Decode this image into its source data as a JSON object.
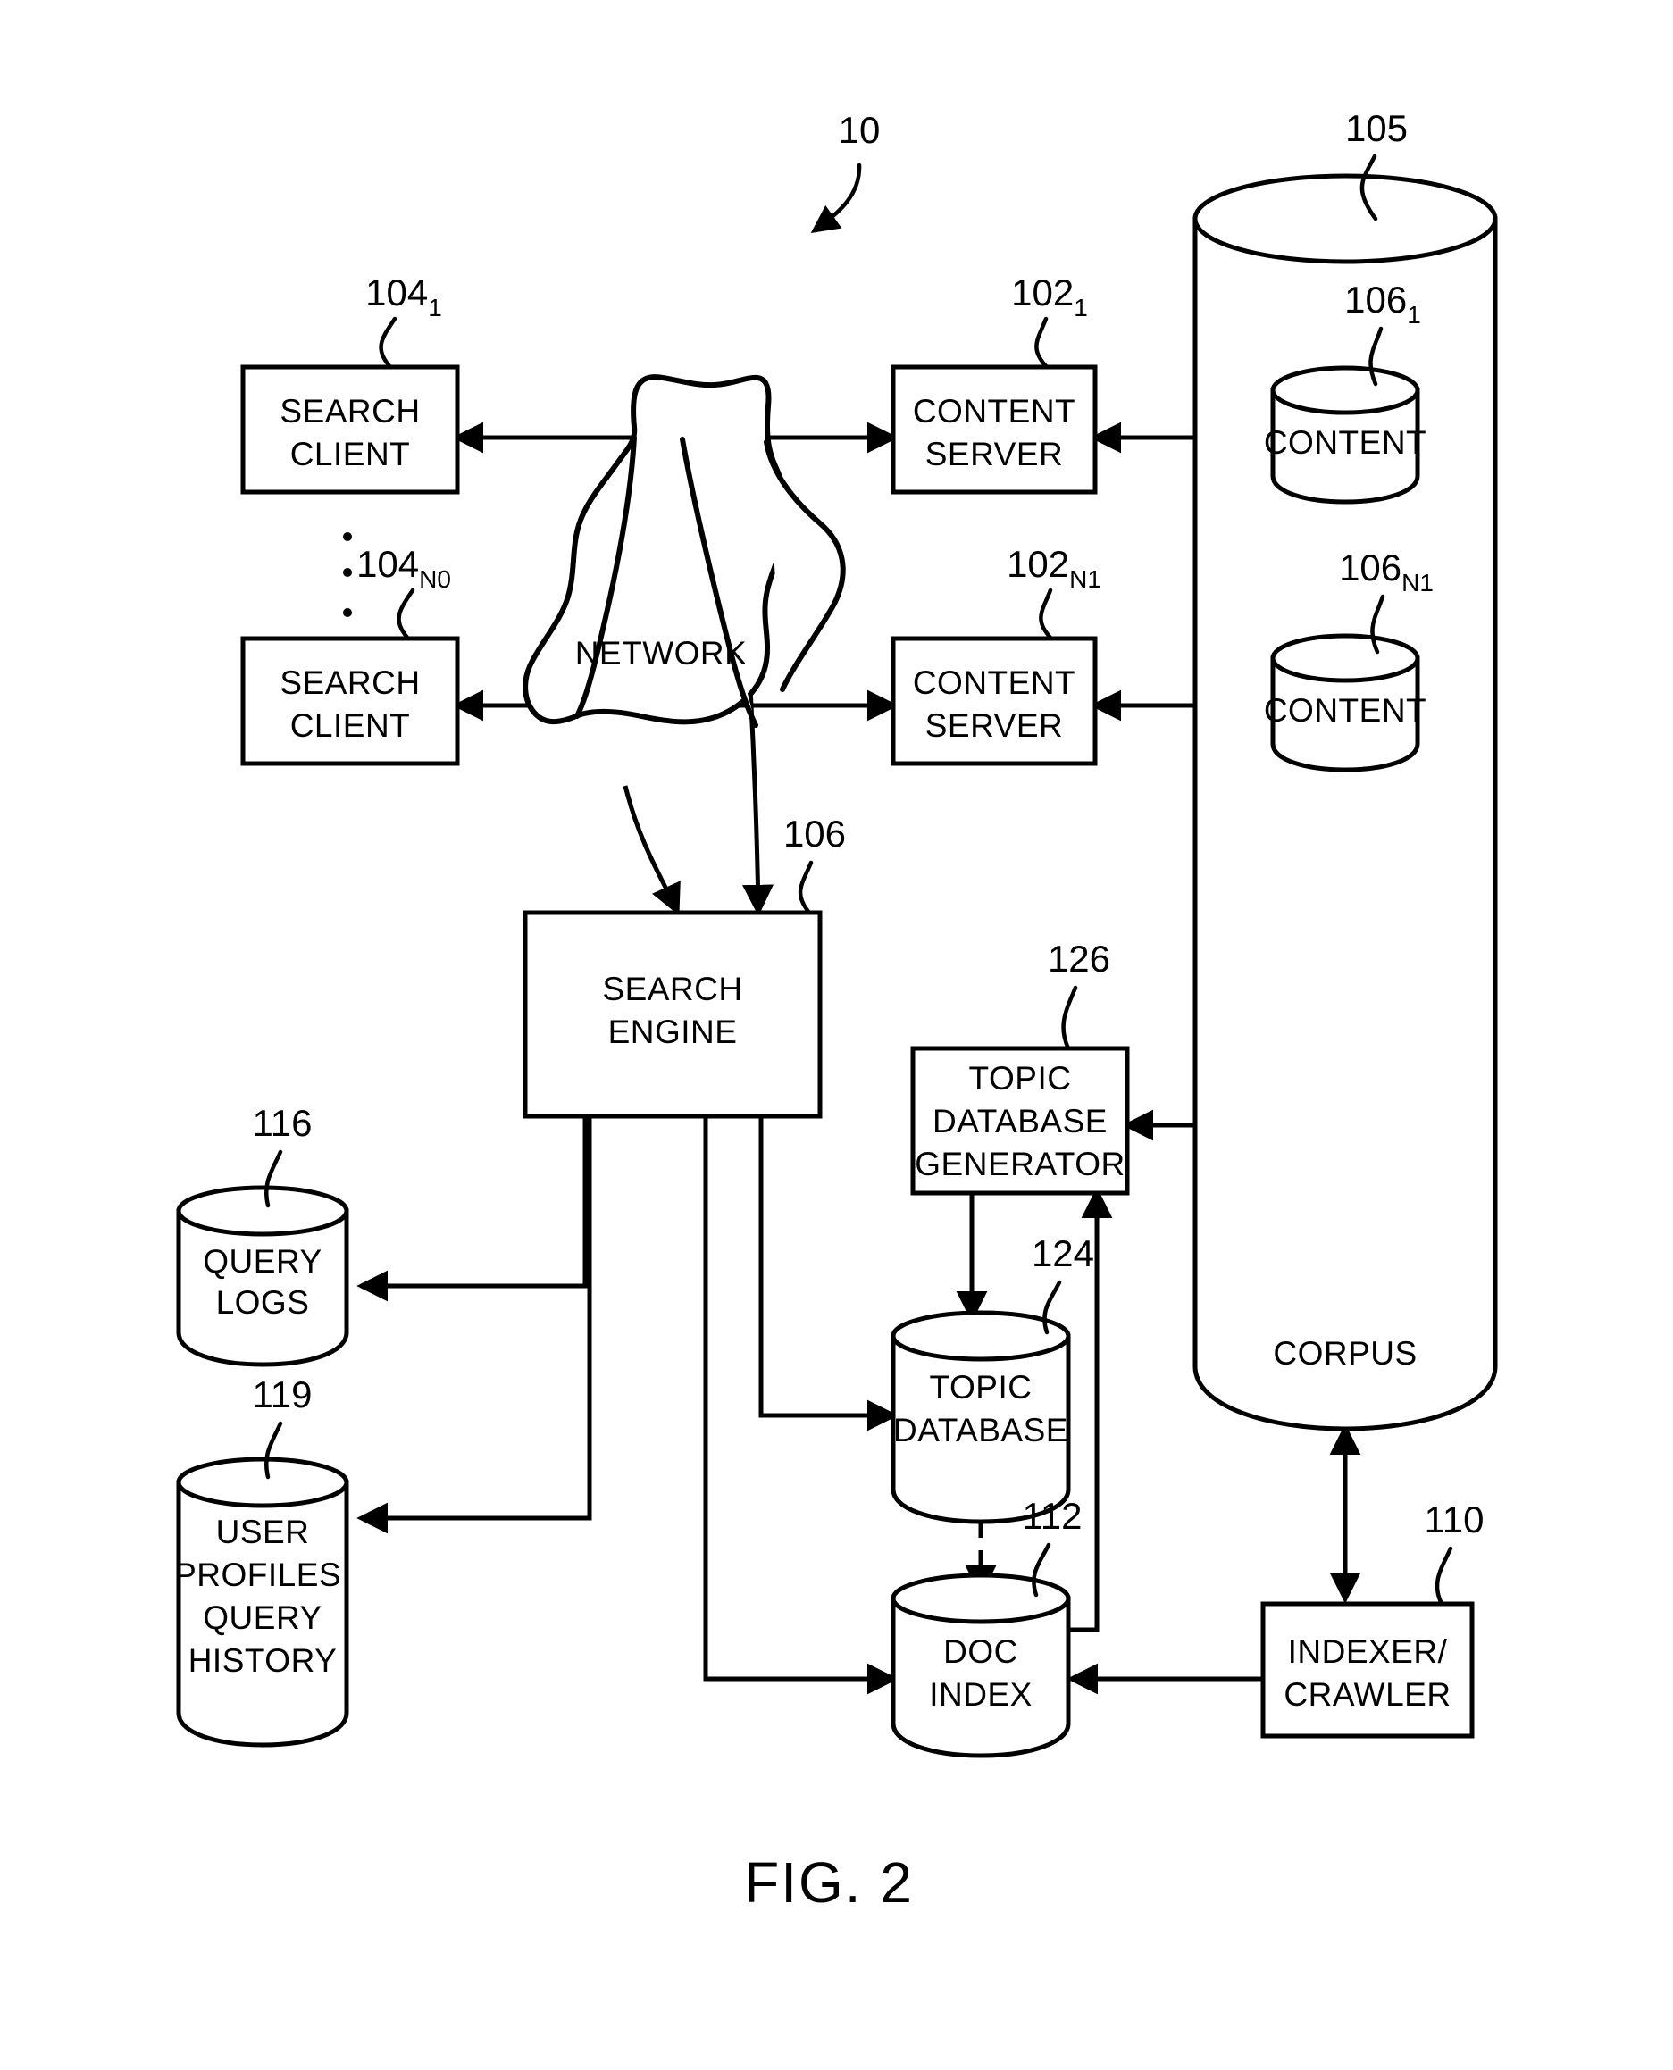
{
  "figure": {
    "caption": "FIG. 2",
    "system_ref": "10"
  },
  "nodes": {
    "search_client_1": {
      "label_line1": "SEARCH",
      "label_line2": "CLIENT",
      "ref": "104",
      "ref_sub": "1"
    },
    "search_client_n": {
      "label_line1": "SEARCH",
      "label_line2": "CLIENT",
      "ref": "104",
      "ref_sub": "N0"
    },
    "network": {
      "label": "NETWORK"
    },
    "content_server_1": {
      "label_line1": "CONTENT",
      "label_line2": "SERVER",
      "ref": "102",
      "ref_sub": "1"
    },
    "content_server_n": {
      "label_line1": "CONTENT",
      "label_line2": "SERVER",
      "ref": "102",
      "ref_sub": "N1"
    },
    "content_1": {
      "label": "CONTENT",
      "ref": "106",
      "ref_sub": "1"
    },
    "content_n": {
      "label": "CONTENT",
      "ref": "106",
      "ref_sub": "N1"
    },
    "corpus": {
      "label": "CORPUS",
      "ref": "105"
    },
    "search_engine": {
      "label_line1": "SEARCH",
      "label_line2": "ENGINE",
      "ref": "106"
    },
    "query_logs": {
      "label_line1": "QUERY",
      "label_line2": "LOGS",
      "ref": "116"
    },
    "user_profiles": {
      "label_line1": "USER",
      "label_line2": "PROFILES,",
      "label_line3": "QUERY",
      "label_line4": "HISTORY",
      "ref": "119"
    },
    "topic_database_generator": {
      "label_line1": "TOPIC",
      "label_line2": "DATABASE",
      "label_line3": "GENERATOR",
      "ref": "126"
    },
    "topic_database": {
      "label_line1": "TOPIC",
      "label_line2": "DATABASE",
      "ref": "124"
    },
    "doc_index": {
      "label_line1": "DOC",
      "label_line2": "INDEX",
      "ref": "112"
    },
    "indexer_crawler": {
      "label_line1": "INDEXER/",
      "label_line2": "CRAWLER",
      "ref": "110"
    }
  }
}
